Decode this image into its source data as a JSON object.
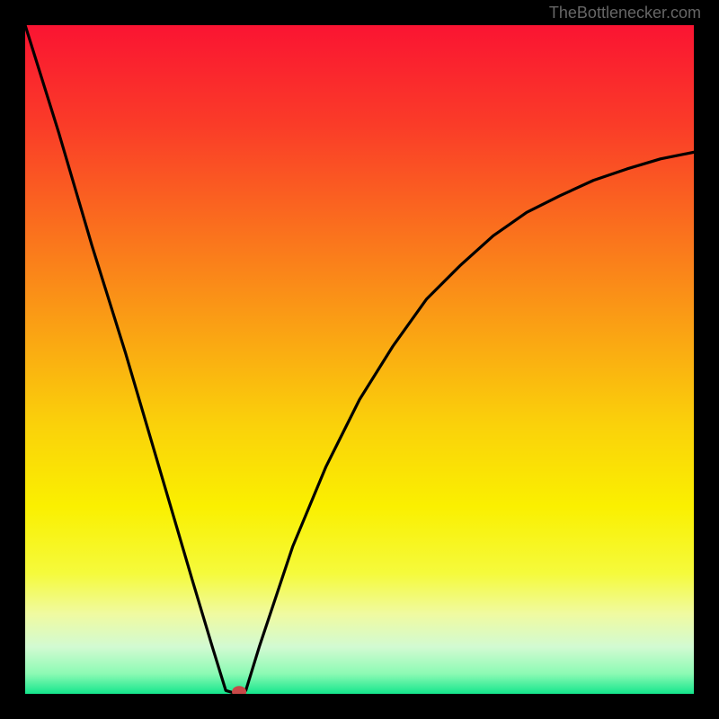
{
  "watermark": "TheBottlenecker.com",
  "chart_data": {
    "type": "line",
    "title": "",
    "xlabel": "",
    "ylabel": "",
    "xlim": [
      0,
      100
    ],
    "ylim": [
      0,
      100
    ],
    "series": [
      {
        "name": "curve",
        "x": [
          0,
          5,
          10,
          15,
          20,
          25,
          28,
          30,
          31,
          32,
          33,
          35,
          40,
          45,
          50,
          55,
          60,
          65,
          70,
          75,
          80,
          85,
          90,
          95,
          100
        ],
        "values": [
          100,
          84,
          67,
          51,
          34,
          17,
          7,
          0.5,
          0.2,
          0.1,
          0.5,
          7,
          22,
          34,
          44,
          52,
          59,
          64,
          68.5,
          72,
          74.5,
          76.8,
          78.5,
          80,
          81
        ]
      }
    ],
    "marker": {
      "x": 32,
      "y": 0.3,
      "color": "#c84848"
    },
    "gradient_stops": [
      {
        "offset": 0,
        "color": "#fa1432"
      },
      {
        "offset": 15,
        "color": "#fa3c28"
      },
      {
        "offset": 30,
        "color": "#fa6e1e"
      },
      {
        "offset": 45,
        "color": "#faa014"
      },
      {
        "offset": 60,
        "color": "#fad20a"
      },
      {
        "offset": 72,
        "color": "#faf000"
      },
      {
        "offset": 82,
        "color": "#f5fa3c"
      },
      {
        "offset": 88,
        "color": "#f0faa0"
      },
      {
        "offset": 93,
        "color": "#d2fad2"
      },
      {
        "offset": 97,
        "color": "#8cfab4"
      },
      {
        "offset": 100,
        "color": "#14e68c"
      }
    ]
  }
}
